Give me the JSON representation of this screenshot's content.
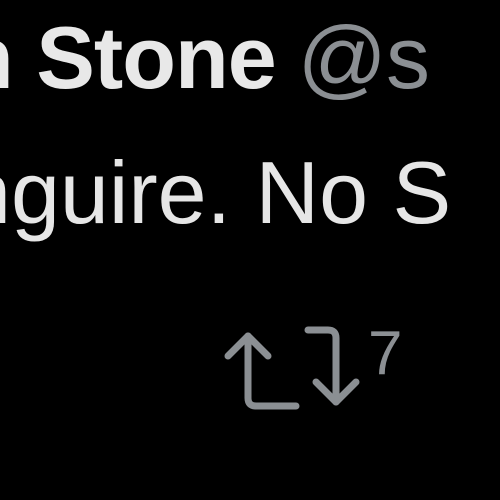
{
  "tweet": {
    "display_name": "n Stone",
    "handle": "@s",
    "text": "nguire. No S",
    "retweet_count": "7"
  },
  "colors": {
    "background": "#000000",
    "primary_text": "#e8e8e8",
    "secondary_text": "#8b8f93"
  },
  "icons": {
    "retweet": "retweet-icon"
  }
}
